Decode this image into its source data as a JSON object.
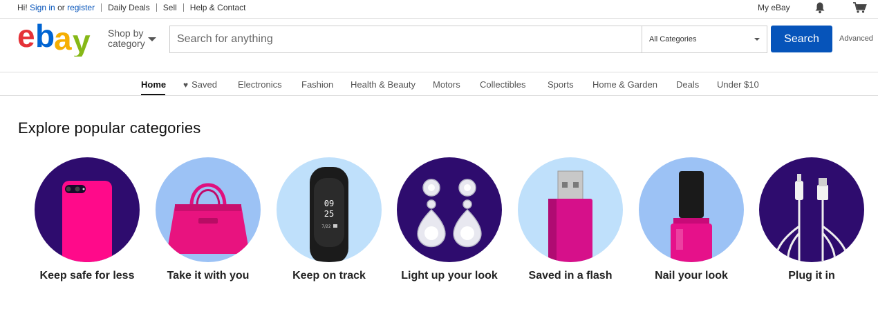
{
  "topbar": {
    "greeting": "Hi!",
    "sign_in": "Sign in",
    "or": "or",
    "register": "register",
    "daily_deals": "Daily Deals",
    "sell": "Sell",
    "help_contact": "Help & Contact",
    "my_ebay": "My eBay"
  },
  "header": {
    "logo_letters": [
      "e",
      "b",
      "a",
      "y"
    ],
    "logo_colors": [
      "#e53238",
      "#0064d2",
      "#f5af02",
      "#86b817"
    ],
    "shop_by_line1": "Shop by",
    "shop_by_line2": "category",
    "search_placeholder": "Search for anything",
    "category_select": "All Categories",
    "search_button": "Search",
    "advanced": "Advanced"
  },
  "nav": {
    "items": [
      "Home",
      "Saved",
      "Electronics",
      "Fashion",
      "Health & Beauty",
      "Motors",
      "Collectibles",
      "Sports",
      "Home & Garden",
      "Deals",
      "Under $10"
    ]
  },
  "main": {
    "title": "Explore popular categories",
    "categories": [
      {
        "label": "Keep safe for less",
        "icon": "phone-case-icon"
      },
      {
        "label": "Take it with you",
        "icon": "handbag-icon"
      },
      {
        "label": "Keep on track",
        "icon": "fitness-tracker-icon"
      },
      {
        "label": "Light up your look",
        "icon": "earrings-icon"
      },
      {
        "label": "Saved in a flash",
        "icon": "usb-drive-icon"
      },
      {
        "label": "Nail your look",
        "icon": "nail-polish-icon"
      },
      {
        "label": "Plug it in",
        "icon": "cable-icon"
      }
    ],
    "tracker_time": [
      "09",
      "25"
    ],
    "tracker_date": "7/22",
    "accent_pink": "#ff0a8a"
  }
}
